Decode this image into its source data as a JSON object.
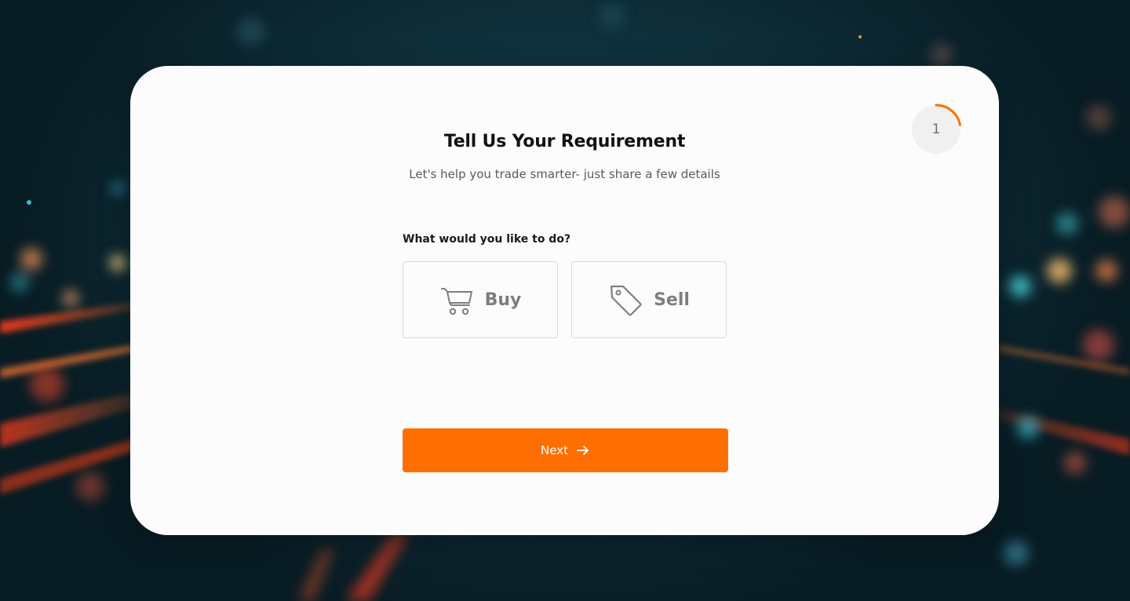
{
  "progress": {
    "step_number": "1",
    "fraction": 0.22,
    "accent_color": "#ff6f00"
  },
  "header": {
    "title": "Tell Us Your Requirement",
    "subtitle": "Let's help you trade smarter- just share a few details"
  },
  "form": {
    "question": "What would you like to do?",
    "options": [
      {
        "label": "Buy",
        "icon": "shopping-cart-icon"
      },
      {
        "label": "Sell",
        "icon": "price-tag-icon"
      }
    ],
    "next_label": "Next",
    "next_icon": "arrow-right-icon"
  },
  "colors": {
    "accent": "#ff6f00",
    "card_background": "#fcfcfc",
    "option_text": "#7e7e7e"
  }
}
